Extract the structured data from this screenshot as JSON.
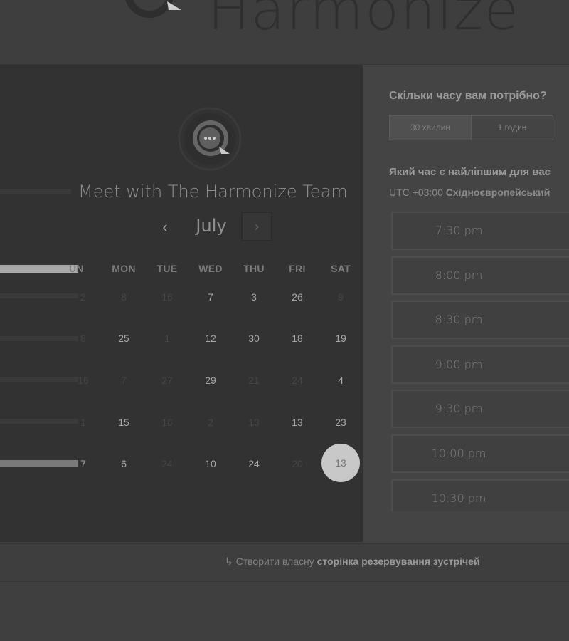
{
  "logo": {
    "text": "Harmonize"
  },
  "left": {
    "title": "Meet with The Harmonize Team",
    "month": "July",
    "prev": "‹",
    "next": "›",
    "weekdays": [
      "UN",
      "MON",
      "TUE",
      "WED",
      "THU",
      "FRI",
      "SAT"
    ],
    "weeks": [
      [
        "2",
        "8",
        "16",
        "7",
        "3",
        "26",
        "9"
      ],
      [
        "8",
        "25",
        "1",
        "12",
        "30",
        "18",
        "19"
      ],
      [
        "16",
        "7",
        "27",
        "29",
        "21",
        "24",
        "4"
      ],
      [
        "1",
        "15",
        "16",
        "2",
        "13",
        "13",
        "23"
      ],
      [
        "7",
        "6",
        "24",
        "10",
        "24",
        "20",
        "13"
      ]
    ],
    "faded": [
      [
        true,
        true,
        true,
        false,
        false,
        false,
        true
      ],
      [
        true,
        false,
        true,
        false,
        false,
        false,
        false
      ],
      [
        true,
        true,
        true,
        false,
        true,
        true,
        false
      ],
      [
        true,
        false,
        true,
        true,
        true,
        false,
        false
      ],
      [
        false,
        false,
        true,
        false,
        false,
        true,
        false
      ]
    ],
    "selected_day": "13"
  },
  "right": {
    "duration_question": "Скільки часу вам потрібно?",
    "durations": [
      "30 хвилин",
      "1 годин"
    ],
    "active_duration": "30 хвилин",
    "time_question": "Який час є найліпшим для вас",
    "tz_prefix": "UTC +03:00 ",
    "tz_name": "Східноєвропейський",
    "slots": [
      "7:30 pm",
      "8:00 pm",
      "8:30 pm",
      "9:00 pm",
      "9:30 pm",
      "10:00 pm",
      "10:30 pm"
    ]
  },
  "footer": {
    "icon": "arrow-icon",
    "prefix": "Створити власну ",
    "bold": "сторінка резервування зустрічей"
  },
  "colors": {
    "background": "#3f3f3f",
    "panel": "#323232",
    "selected": "#c8c8c8"
  }
}
